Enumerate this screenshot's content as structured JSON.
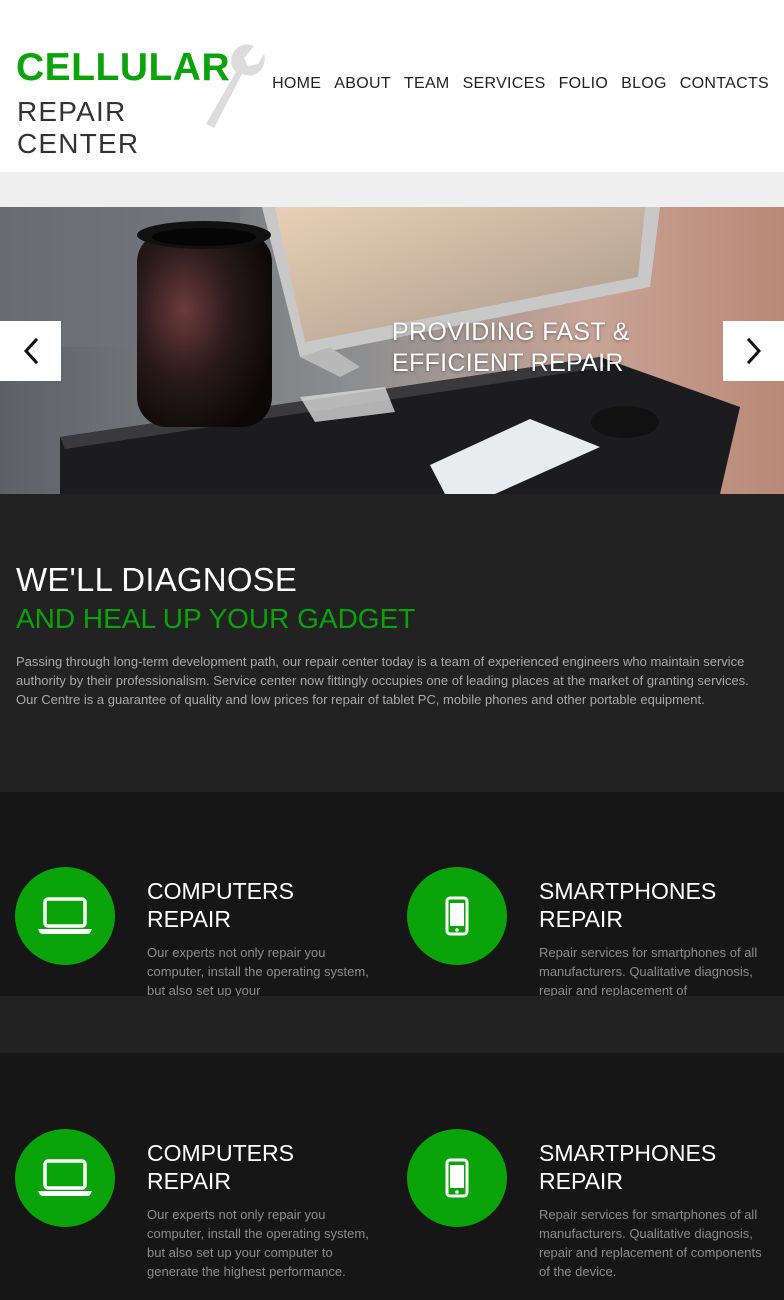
{
  "logo": {
    "line1": "CELLULAR",
    "line2": "REPAIR CENTER"
  },
  "nav": [
    "HOME",
    "ABOUT",
    "TEAM",
    "SERVICES",
    "FOLIO",
    "BLOG",
    "CONTACTS"
  ],
  "hero": {
    "caption_line1": "PROVIDING FAST &",
    "caption_line2": "EFFICIENT REPAIR"
  },
  "intro": {
    "title": "WE'LL DIAGNOSE",
    "subtitle": "AND HEAL UP YOUR GADGET",
    "text": "Passing through long-term development path, our repair center today is a team of experienced engineers who maintain service authority by their professionalism. Service center now fittingly occupies one of leading places at the market of granting services.  Our Centre is a guarantee of quality and low prices for repair of tablet PC, mobile phones and other portable equipment."
  },
  "services_row1": [
    {
      "title_1": "COMPUTERS",
      "title_2": "REPAIR",
      "text": "Our experts not only repair you computer, install the operating system, but also set up your",
      "icon": "laptop-icon"
    },
    {
      "title_1": "SMARTPHONES",
      "title_2": "REPAIR",
      "text": "Repair services for smartphones of all manufacturers. Qualitative diagnosis, repair and replacement of",
      "icon": "smartphone-icon"
    }
  ],
  "services_row2": [
    {
      "title_1": "COMPUTERS",
      "title_2": "REPAIR",
      "text": "Our experts not only repair you computer, install the operating system, but also set up your computer to generate the highest performance.",
      "icon": "laptop-icon"
    },
    {
      "title_1": "SMARTPHONES",
      "title_2": "REPAIR",
      "text": "Repair services for smartphones of all manufacturers. Qualitative diagnosis, repair and replacement of components of the device.",
      "icon": "smartphone-icon"
    }
  ],
  "colors": {
    "accent": "#0aa30a",
    "dark": "#222222",
    "darker": "#161616"
  }
}
